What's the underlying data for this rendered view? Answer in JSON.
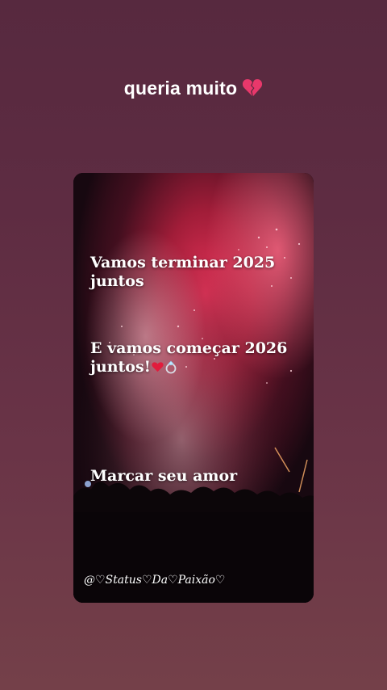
{
  "story": {
    "caption": "queria muito",
    "caption_emoji": "broken-heart-icon"
  },
  "post": {
    "line1": "Vamos terminar 2025",
    "line1b": "juntos",
    "line2": "E vamos começar 2026",
    "line2b": "juntos!",
    "line2_emojis": [
      "red-heart-icon",
      "ring-icon"
    ],
    "line3": "Marcar seu amor",
    "watermark": "@♡Status♡Da♡Paixão♡"
  },
  "colors": {
    "background_top": "#57293f",
    "background_bottom": "#744049",
    "firework": "#ff3d5e"
  }
}
